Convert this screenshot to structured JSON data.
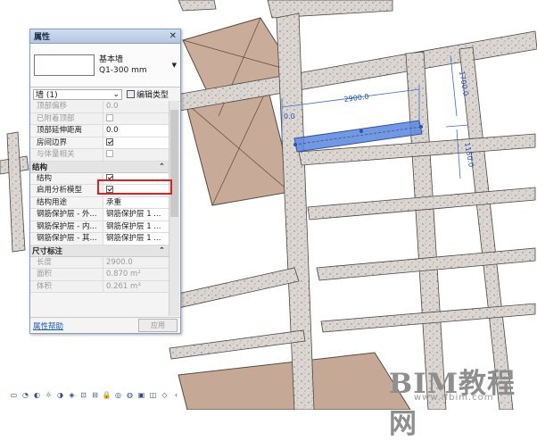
{
  "palette": {
    "title": "属性",
    "type_name": "基本墙",
    "type_sub": "Q1-300 mm",
    "instance_filter": "墙 (1)",
    "edit_type": "编辑类型",
    "groups": {
      "constraints_rows": [
        {
          "k": "顶部偏移",
          "v": "0.0",
          "dim": true
        },
        {
          "k": "已附着顶部",
          "v": "",
          "cb": "off",
          "dim": true
        },
        {
          "k": "顶部延伸距离",
          "v": "0.0",
          "dim": false
        },
        {
          "k": "房间边界",
          "v": "",
          "cb": "on",
          "dim": false
        },
        {
          "k": "与体量相关",
          "v": "",
          "cb": "off",
          "dim": true
        }
      ],
      "structure": "结构",
      "structure_rows": [
        {
          "k": "结构",
          "v": "",
          "cb": "on",
          "dim": false
        },
        {
          "k": "启用分析模型",
          "v": "",
          "cb": "on",
          "dim": false
        },
        {
          "k": "结构用途",
          "v": "承重",
          "dim": false
        },
        {
          "k": "钢筋保护层 - 外...",
          "v": "钢筋保护层 1 ...",
          "dim": false
        },
        {
          "k": "钢筋保护层 - 内...",
          "v": "钢筋保护层 1 ...",
          "dim": false
        },
        {
          "k": "钢筋保护层 - 其...",
          "v": "钢筋保护层 1 ...",
          "dim": false
        }
      ],
      "dimensions": "尺寸标注",
      "dimension_rows": [
        {
          "k": "长度",
          "v": "2900.0",
          "dim": true
        },
        {
          "k": "面积",
          "v": "0.870 m²",
          "dim": true
        },
        {
          "k": "体积",
          "v": "0.261 m³",
          "dim": true
        }
      ]
    },
    "help": "属性帮助",
    "apply": "应用"
  },
  "dimensions_2d": {
    "d1": "2900.0",
    "d2": "1700.0",
    "d3": "1150.0",
    "d4": "0.0"
  },
  "watermark": {
    "big": "BIM教程网",
    "small": "www.ifbim.com"
  },
  "colors": {
    "beam": "#dcd6d3",
    "roof": "#c4aa98",
    "select": "#4a78d8"
  }
}
